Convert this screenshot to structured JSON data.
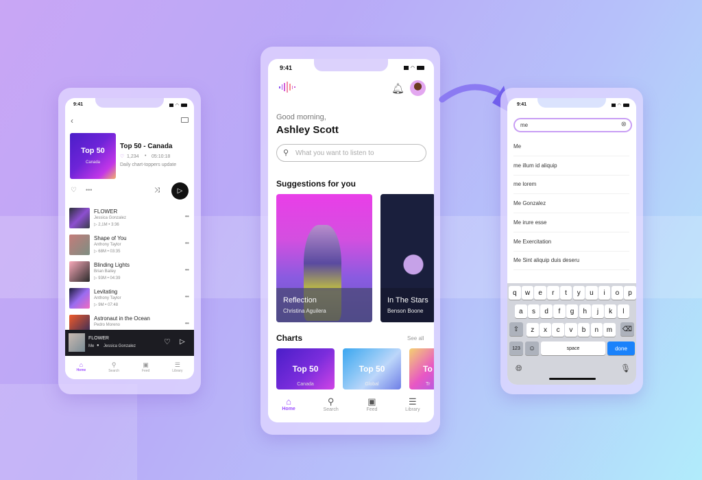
{
  "status_time": "9:41",
  "left_screen": {
    "playlist": {
      "cover_title": "Top 50",
      "cover_sub": "Canada",
      "title": "Top 50 - Canada",
      "likes": "1,234",
      "duration": "05:10:18",
      "description": "Daily chart-toppers update"
    },
    "songs": [
      {
        "title": "FLOWER",
        "artist": "Jessica Gonzalez",
        "plays": "2,1M",
        "length": "3:36"
      },
      {
        "title": "Shape of You",
        "artist": "Anthony Taylor",
        "plays": "68M",
        "length": "03:35"
      },
      {
        "title": "Blinding Lights",
        "artist": "Brian Bailey",
        "plays": "93M",
        "length": "04:39"
      },
      {
        "title": "Levitating",
        "artist": "Anthony Taylor",
        "plays": "9M",
        "length": "07:48"
      },
      {
        "title": "Astronaut in the Ocean",
        "artist": "Pedro Moreno",
        "plays": "",
        "length": ""
      }
    ],
    "now_playing": {
      "title": "FLOWER",
      "source": "Me",
      "artist": "Jessica Gonzalez"
    },
    "tabs": [
      "Home",
      "Search",
      "Feed",
      "Library"
    ]
  },
  "center_screen": {
    "greeting": "Good morning,",
    "user_name": "Ashley Scott",
    "search_placeholder": "What you want to listen to",
    "suggestions_title": "Suggestions for you",
    "suggestions": [
      {
        "title": "Reflection",
        "artist": "Christina Aguilera"
      },
      {
        "title": "In The Stars",
        "artist": "Benson Boone"
      }
    ],
    "charts_title": "Charts",
    "see_all": "See all",
    "charts": [
      {
        "title": "Top 50",
        "sub": "Canada"
      },
      {
        "title": "Top 50",
        "sub": "Global"
      },
      {
        "title": "To",
        "sub": "Tr"
      }
    ],
    "tabs": [
      "Home",
      "Search",
      "Feed",
      "Library"
    ]
  },
  "right_screen": {
    "search_value": "me",
    "suggestions": [
      "Me",
      "me illum id aliquip",
      "me lorem",
      "Me Gonzalez",
      "Me irure esse",
      "Me Exercitation",
      "Me Sint aliquip duis deseru"
    ],
    "keyboard": {
      "row1": [
        "q",
        "w",
        "e",
        "r",
        "t",
        "y",
        "u",
        "i",
        "o",
        "p"
      ],
      "row2": [
        "a",
        "s",
        "d",
        "f",
        "g",
        "h",
        "j",
        "k",
        "l"
      ],
      "row3": [
        "z",
        "x",
        "c",
        "v",
        "b",
        "n",
        "m"
      ],
      "numbers": "123",
      "space": "space",
      "done": "done"
    }
  },
  "colors": {
    "accent": "#9b4dff",
    "done_blue": "#1a82fb",
    "player_bg": "#1c1c22"
  }
}
